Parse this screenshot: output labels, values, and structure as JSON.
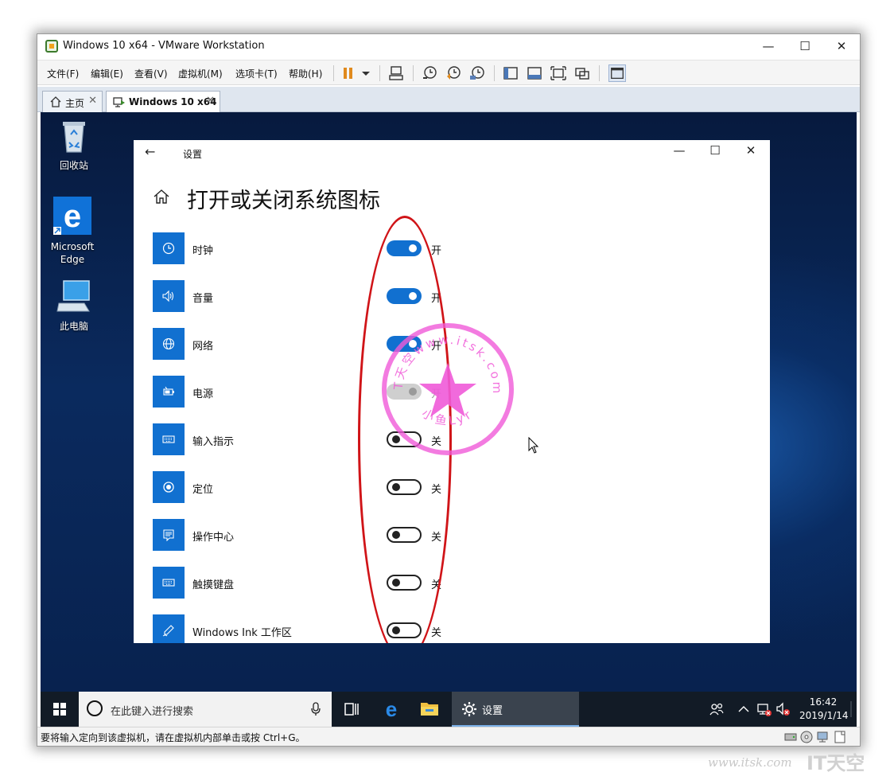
{
  "vmware": {
    "title": "Windows 10 x64 - VMware Workstation",
    "window_controls": {
      "minimize": "—",
      "maximize": "☐",
      "close": "✕"
    },
    "menu": [
      "文件(F)",
      "编辑(E)",
      "查看(V)",
      "虚拟机(M)",
      "选项卡(T)",
      "帮助(H)"
    ],
    "tabs": [
      {
        "label": "主页",
        "close": "✕"
      },
      {
        "label": "Windows 10 x64",
        "close": "✕"
      }
    ],
    "status_bar": "要将输入定向到该虚拟机，请在虚拟机内部单击或按 Ctrl+G。"
  },
  "desktop": {
    "icons": [
      "回收站",
      "Microsoft Edge",
      "此电脑"
    ]
  },
  "settings": {
    "back": "←",
    "app_name": "设置",
    "controls": {
      "minimize": "—",
      "maximize": "☐",
      "close": "✕"
    },
    "page_title": "打开或关闭系统图标",
    "rows": [
      {
        "label": "时钟",
        "state": "开"
      },
      {
        "label": "音量",
        "state": "开"
      },
      {
        "label": "网络",
        "state": "开"
      },
      {
        "label": "电源",
        "state": "开"
      },
      {
        "label": "输入指示",
        "state": "关"
      },
      {
        "label": "定位",
        "state": "关"
      },
      {
        "label": "操作中心",
        "state": "关"
      },
      {
        "label": "触摸键盘",
        "state": "关"
      },
      {
        "label": "Windows Ink 工作区",
        "state": "关"
      }
    ]
  },
  "taskbar": {
    "search_placeholder": "在此键入进行搜索",
    "active_app": "设置",
    "time": "16:42",
    "date": "2019/1/14"
  },
  "stamp": {
    "top_text": "IT天空www.itsk.com",
    "bottom_text": "小鱼Lyr"
  },
  "watermark": {
    "url": "www.itsk.com",
    "brand": "IT天空"
  },
  "colors": {
    "accent": "#1170d0",
    "annotation_red": "#d01418",
    "stamp_pink": "#f05ad8",
    "taskbar": "#121b26"
  }
}
